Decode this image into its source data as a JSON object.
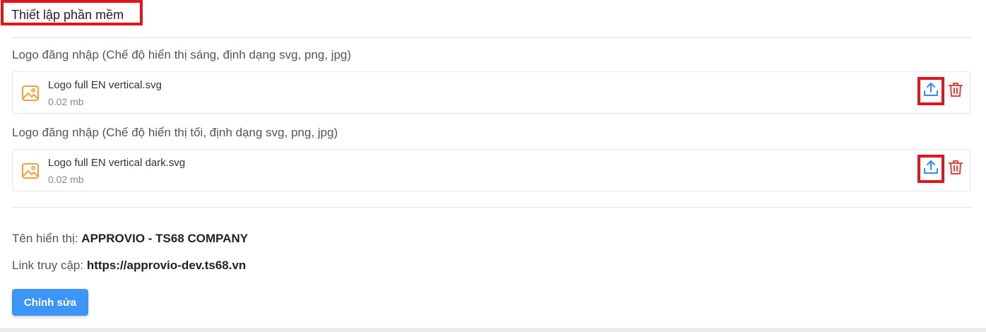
{
  "section": {
    "title": "Thiết lập phần mềm"
  },
  "logos": [
    {
      "label": "Logo đăng nhập (Chế độ hiển thị sáng, định dạng svg, png, jpg)",
      "file_name": "Logo full EN vertical.svg",
      "file_size": "0.02 mb"
    },
    {
      "label": "Logo đăng nhập (Chế độ hiển thị tối, định dạng svg, png, jpg)",
      "file_name": "Logo full EN vertical dark.svg",
      "file_size": "0.02 mb"
    }
  ],
  "info": {
    "display_name_label": "Tên hiển thị:",
    "display_name_value": "APPROVIO - TS68 COMPANY",
    "access_link_label": "Link truy cập:",
    "access_link_value": "https://approvio-dev.ts68.vn"
  },
  "actions": {
    "edit_label": "Chỉnh sửa"
  },
  "colors": {
    "accent": "#3d95f7",
    "highlight_box": "#e3141b",
    "image_icon": "#f2a03d",
    "upload_icon": "#2f8ef0",
    "delete_icon": "#e8413c"
  },
  "icons": {
    "file": "image-icon",
    "upload": "upload-icon",
    "delete": "trash-icon"
  }
}
